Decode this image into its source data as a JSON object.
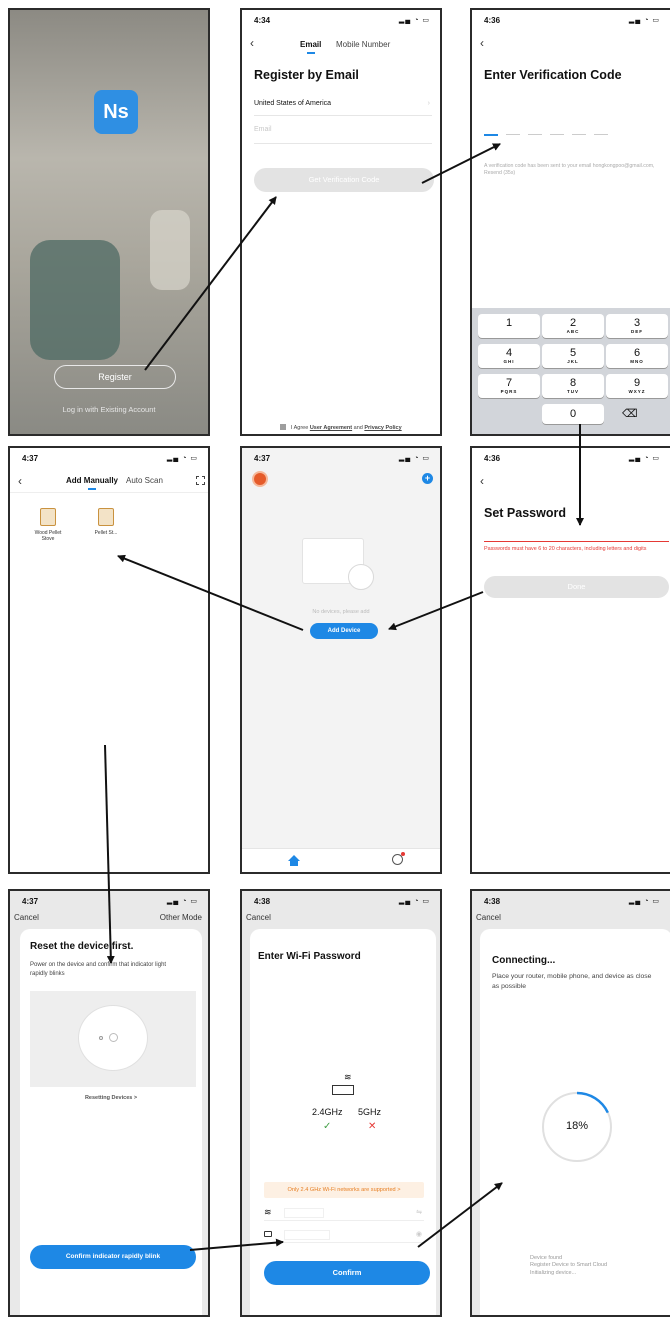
{
  "colors": {
    "accent": "#1e88e5",
    "error": "#e53935",
    "success": "#43a047",
    "gray_bg": "#f2f2f2",
    "nav_home": "#1e88e5"
  },
  "s1": {
    "logo": "Ns",
    "register": "Register",
    "login": "Log in with Existing Account"
  },
  "s2": {
    "time": "4:34",
    "tab_email": "Email",
    "tab_mobile": "Mobile Number",
    "title": "Register by Email",
    "country": "United States of America",
    "email_placeholder": "Email",
    "get_code": "Get Verification Code",
    "agree_prefix": "I Agree",
    "user_agreement": "User Agreement",
    "and": "and",
    "privacy": "Privacy Policy"
  },
  "s3": {
    "time": "4:36",
    "title": "Enter Verification Code",
    "hint": "A verification code has been sent to your email hongkongpoo@gmail.com, Resend (35s)",
    "keys": [
      {
        "n": "1",
        "l": ""
      },
      {
        "n": "2",
        "l": "ABC"
      },
      {
        "n": "3",
        "l": "DEF"
      },
      {
        "n": "4",
        "l": "GHI"
      },
      {
        "n": "5",
        "l": "JKL"
      },
      {
        "n": "6",
        "l": "MNO"
      },
      {
        "n": "7",
        "l": "PQRS"
      },
      {
        "n": "8",
        "l": "TUV"
      },
      {
        "n": "9",
        "l": "WXYZ"
      }
    ],
    "zero": "0",
    "delete_glyph": "⌫"
  },
  "s4": {
    "time": "4:37",
    "tab_manual": "Add Manually",
    "tab_auto": "Auto Scan",
    "device1": "Wood Pellet Stove",
    "device2": "Pellet St..."
  },
  "s5": {
    "time": "4:37",
    "empty": "No devices, please add",
    "add_device": "Add Device"
  },
  "s6": {
    "time": "4:36",
    "title": "Set Password",
    "error": "Passwords must have 6 to 20 characters, including letters and digits",
    "done": "Done"
  },
  "s7": {
    "time": "4:37",
    "cancel": "Cancel",
    "other_mode": "Other Mode",
    "title": "Reset the device first.",
    "desc": "Power on the device and confirm that indicator light rapidly blinks",
    "resetting": "Resetting Devices >",
    "confirm": "Confirm indicator rapidly blink"
  },
  "s8": {
    "time": "4:38",
    "cancel": "Cancel",
    "title": "Enter Wi-Fi Password",
    "band24": "2.4GHz",
    "band5": "5GHz",
    "warning": "Only 2.4 GHz Wi-Fi networks are supported >",
    "confirm": "Confirm"
  },
  "s9": {
    "time": "4:38",
    "cancel": "Cancel",
    "title": "Connecting...",
    "desc": "Place your router, mobile phone, and device as close as possible",
    "progress": 18,
    "progress_label": "18%",
    "status1": "Device found",
    "status2": "Register Device to Smart Cloud",
    "status3": "Initializing device..."
  }
}
